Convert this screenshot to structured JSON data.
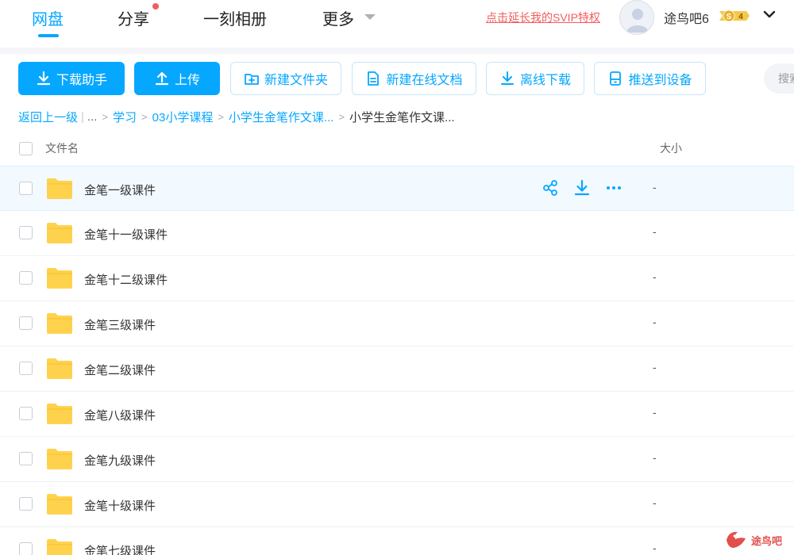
{
  "nav": {
    "items": [
      {
        "label": "网盘",
        "active": true
      },
      {
        "label": "分享",
        "active": false
      },
      {
        "label": "一刻相册",
        "active": false
      },
      {
        "label": "更多",
        "active": false
      }
    ],
    "svip_link": "点击延长我的SVIP特权",
    "username": "途鸟吧6",
    "vip_level": "4",
    "vip_symbol": "S"
  },
  "toolbar": {
    "download_helper": "下载助手",
    "upload": "上传",
    "new_folder": "新建文件夹",
    "new_online_doc": "新建在线文档",
    "offline_download": "离线下载",
    "push_to_device": "推送到设备",
    "search_placeholder": "搜索"
  },
  "breadcrumb": {
    "back": "返回上一级",
    "ellipsis": "...",
    "crumbs": [
      "学习",
      "03小学课程",
      "小学生金笔作文课..."
    ],
    "current": "小学生金笔作文课..."
  },
  "table": {
    "col_name": "文件名",
    "col_size": "大小",
    "rows": [
      {
        "name": "金笔一级课件",
        "size": "-"
      },
      {
        "name": "金笔十一级课件",
        "size": "-"
      },
      {
        "name": "金笔十二级课件",
        "size": "-"
      },
      {
        "name": "金笔三级课件",
        "size": "-"
      },
      {
        "name": "金笔二级课件",
        "size": "-"
      },
      {
        "name": "金笔八级课件",
        "size": "-"
      },
      {
        "name": "金笔九级课件",
        "size": "-"
      },
      {
        "name": "金笔十级课件",
        "size": "-"
      },
      {
        "name": "金笔七级课件",
        "size": "-"
      }
    ]
  },
  "watermark": {
    "text": "途鸟吧"
  },
  "colors": {
    "accent": "#06a7ff",
    "alert": "#f25c5c",
    "folder": "#ffd24d"
  },
  "icons": {
    "download": "download-icon",
    "upload": "upload-icon",
    "new_folder": "folder-plus-icon",
    "new_doc": "document-icon",
    "offline": "download-icon",
    "device": "device-icon",
    "share": "share-icon",
    "more": "more-dots-icon",
    "folder": "folder-icon",
    "chevron": "chevron-down-icon"
  }
}
